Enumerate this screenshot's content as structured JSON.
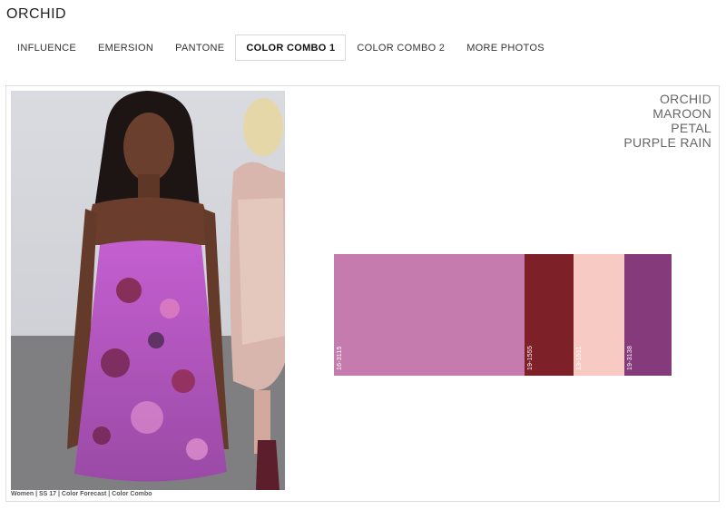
{
  "page": {
    "title": "ORCHID"
  },
  "tabs": [
    {
      "label": "INFLUENCE"
    },
    {
      "label": "EMERSION"
    },
    {
      "label": "PANTONE"
    },
    {
      "label": "COLOR COMBO 1"
    },
    {
      "label": "COLOR COMBO 2"
    },
    {
      "label": "MORE PHOTOS"
    }
  ],
  "active_tab": "COLOR COMBO 1",
  "photo": {
    "caption": "Women | SS 17 | Color Forecast | Color Combo"
  },
  "combo": {
    "names": [
      "ORCHID",
      "MAROON",
      "PETAL",
      "PURPLE RAIN"
    ],
    "swatches": [
      {
        "code": "16-3115",
        "color": "#c67bae"
      },
      {
        "code": "19-1555",
        "color": "#7e2027"
      },
      {
        "code": "13-1511",
        "color": "#f7cac4"
      },
      {
        "code": "19-3138",
        "color": "#853a7c"
      }
    ]
  }
}
